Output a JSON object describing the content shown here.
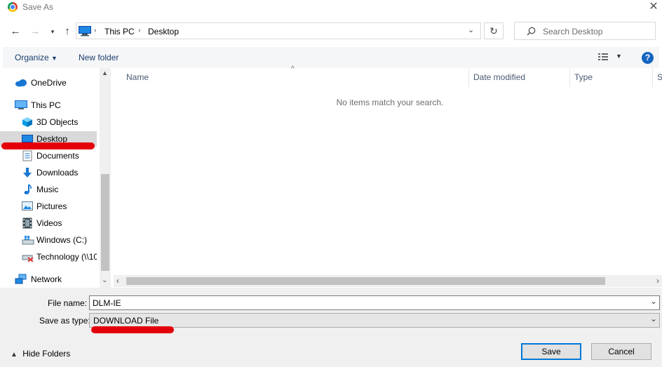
{
  "window": {
    "title": "Save As"
  },
  "nav": {
    "breadcrumb": [
      "This PC",
      "Desktop"
    ],
    "search_placeholder": "Search Desktop"
  },
  "toolbar": {
    "organize_label": "Organize",
    "new_folder_label": "New folder"
  },
  "sidebar": {
    "items": [
      {
        "label": "OneDrive"
      },
      {
        "label": "This PC"
      },
      {
        "label": "3D Objects"
      },
      {
        "label": "Desktop"
      },
      {
        "label": "Documents"
      },
      {
        "label": "Downloads"
      },
      {
        "label": "Music"
      },
      {
        "label": "Pictures"
      },
      {
        "label": "Videos"
      },
      {
        "label": "Windows (C:)"
      },
      {
        "label": "Technology (\\\\10"
      },
      {
        "label": "Network"
      }
    ],
    "selected": "Desktop"
  },
  "content": {
    "columns": [
      "Name",
      "Date modified",
      "Type",
      "S"
    ],
    "empty_message": "No items match your search."
  },
  "form": {
    "file_name_label": "File name:",
    "file_name_value": "DLM-IE",
    "save_type_label": "Save as type:",
    "save_type_value": "DOWNLOAD File"
  },
  "footer": {
    "hide_folders_label": "Hide Folders",
    "save_label": "Save",
    "cancel_label": "Cancel"
  },
  "colors": {
    "accent": "#0078d7",
    "annotation_red": "#e3000b",
    "selected_bg": "#d9d9d9"
  }
}
